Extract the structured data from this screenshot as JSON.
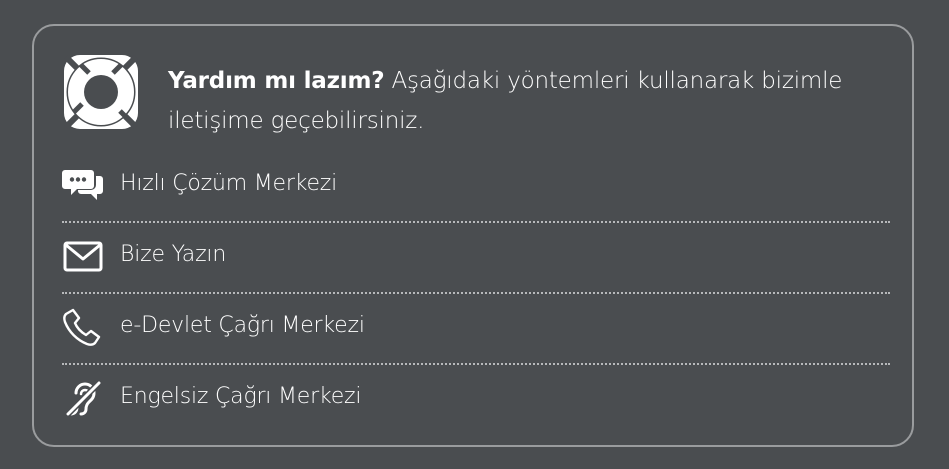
{
  "help": {
    "title_bold": "Yardım mı lazım?",
    "title_rest": " Aşağıdaki yöntemleri kullanarak bizimle iletişime geçebilirsiniz.",
    "icon": "lifebuoy-icon"
  },
  "items": [
    {
      "label": "Hızlı Çözüm Merkezi",
      "icon": "chat-bubbles-icon"
    },
    {
      "label": "Bize Yazın",
      "icon": "envelope-icon"
    },
    {
      "label": "e-Devlet Çağrı Merkezi",
      "icon": "phone-icon"
    },
    {
      "label": "Engelsiz Çağrı Merkezi",
      "icon": "hearing-impaired-icon"
    }
  ],
  "colors": {
    "background": "#4a4d50",
    "border": "#9a9c9e",
    "text": "#ffffff",
    "divider": "#b7b9bb"
  }
}
